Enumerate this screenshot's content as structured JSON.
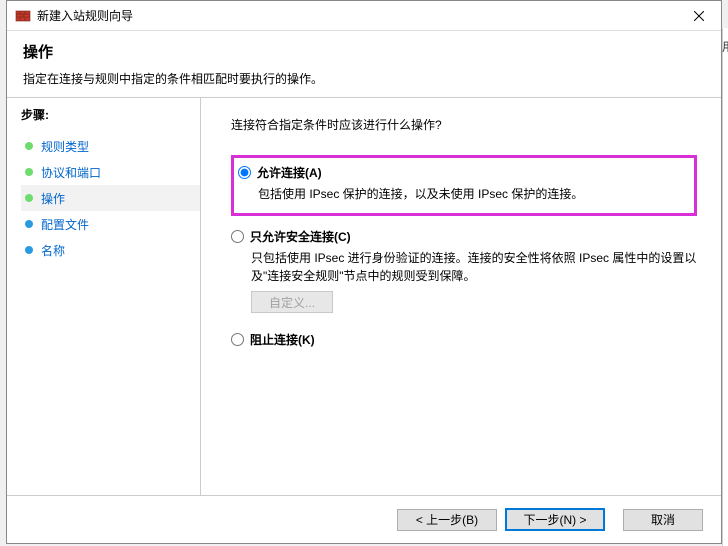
{
  "window": {
    "title": "新建入站规则向导"
  },
  "header": {
    "title": "操作",
    "description": "指定在连接与规则中指定的条件相匹配时要执行的操作。"
  },
  "sidebar": {
    "heading": "步骤:",
    "items": [
      {
        "label": "规则类型",
        "color": "#6edc6e",
        "current": false
      },
      {
        "label": "协议和端口",
        "color": "#6edc6e",
        "current": false
      },
      {
        "label": "操作",
        "color": "#6edc6e",
        "current": true
      },
      {
        "label": "配置文件",
        "color": "#2a9be0",
        "current": false
      },
      {
        "label": "名称",
        "color": "#2a9be0",
        "current": false
      }
    ]
  },
  "main": {
    "question": "连接符合指定条件时应该进行什么操作?",
    "options": {
      "allow": {
        "label": "允许连接(A)",
        "desc": "包括使用 IPsec 保护的连接，以及未使用 IPsec 保护的连接。"
      },
      "allow_secure": {
        "label": "只允许安全连接(C)",
        "desc": "只包括使用 IPsec 进行身份验证的连接。连接的安全性将依照 IPsec 属性中的设置以及\"连接安全规则\"节点中的规则受到保障。",
        "custom_btn": "自定义..."
      },
      "block": {
        "label": "阻止连接(K)"
      }
    }
  },
  "footer": {
    "back": "< 上一步(B)",
    "next": "下一步(N) >",
    "cancel": "取消"
  },
  "edge_char": "用"
}
